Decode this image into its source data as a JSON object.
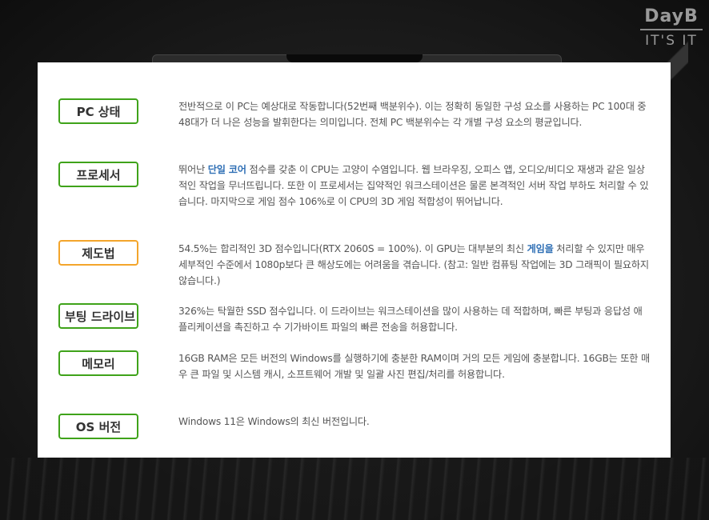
{
  "logo": {
    "line1": "DayB",
    "line2": "IT'S IT"
  },
  "rows": [
    {
      "label": "PC 상태",
      "status": "good",
      "text": "전반적으로 이 PC는 예상대로 작동합니다(52번째 백분위수). 이는 정확히 동일한 구성 요소를 사용하는 PC 100대 중 48대가 더 나은 성능을 발휘한다는 의미입니다. 전체 PC 백분위수는 각 개별 구성 요소의 평균입니다."
    },
    {
      "label": "프로세서",
      "status": "good",
      "text_before": "뛰어난 ",
      "highlight": "단일 코어",
      "text_after": " 점수를 갖춘 이 CPU는 고양이 수염입니다. 웹 브라우징, 오피스 앱, 오디오/비디오 재생과 같은 일상적인 작업을 무너뜨립니다. 또한 이 프로세서는 집약적인 워크스테이션은 물론 본격적인 서버 작업 부하도 처리할 수 있습니다. 마지막으로 게임 점수 106%로 이 CPU의 3D 게임 적합성이 뛰어납니다."
    },
    {
      "label": "제도법",
      "status": "warn",
      "text_before": "54.5%는 합리적인 3D 점수입니다(RTX 2060S = 100%). 이 GPU는 대부분의 최신 ",
      "highlight": "게임을",
      "text_after": " 처리할 수 있지만 매우 세부적인 수준에서 1080p보다 큰 해상도에는 어려움을 겪습니다. (참고: 일반 컴퓨팅 작업에는 3D 그래픽이 필요하지 않습니다.)"
    },
    {
      "label": "부팅 드라이브",
      "status": "good",
      "text": "326%는 탁월한 SSD 점수입니다. 이 드라이브는 워크스테이션을 많이 사용하는 데 적합하며, 빠른 부팅과 응답성 애플리케이션을 촉진하고 수 기가바이트 파일의 빠른 전송을 허용합니다."
    },
    {
      "label": "메모리",
      "status": "good",
      "text": "16GB RAM은 모든 버전의 Windows를 실행하기에 충분한 RAM이며 거의 모든 게임에 충분합니다. 16GB는 또한 매우 큰 파일 및 시스템 캐시, 소프트웨어 개발 및 일괄 사진 편집/처리를 허용합니다."
    },
    {
      "label": "OS 버전",
      "status": "good",
      "text": "Windows 11은 Windows의 최신 버전입니다."
    }
  ],
  "colors": {
    "good_border": "#3fa31a",
    "warn_border": "#f3a52b",
    "link": "#2f6fb5"
  }
}
